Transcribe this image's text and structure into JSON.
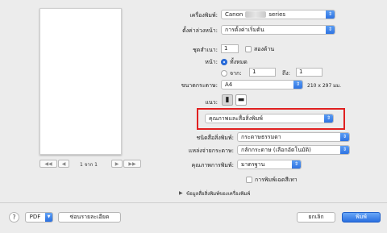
{
  "printer": {
    "label": "เครื่องพิมพ์:",
    "value_prefix": "Canon",
    "value_suffix": "series"
  },
  "presets": {
    "label": "ตั้งค่าล่วงหน้า:",
    "value": "การตั้งค่าเริ่มต้น"
  },
  "copies": {
    "label": "ชุดสำเนา:",
    "value": "1",
    "two_sided_label": "สองด้าน"
  },
  "pages": {
    "label": "หน้า:",
    "all_label": "ทั้งหมด",
    "from_label": "จาก:",
    "from_value": "1",
    "to_label": "ถึง:",
    "to_value": "1"
  },
  "paper_size": {
    "label": "ขนาดกระดาษ:",
    "value": "A4",
    "dimensions": "210 x 297 มม."
  },
  "orientation": {
    "label": "แนว:"
  },
  "section_popup": {
    "value": "คุณภาพและสื่อสิ่งพิมพ์"
  },
  "media_type": {
    "label": "ชนิดสื่อสิ่งพิมพ์:",
    "value": "กระดาษธรรมดา"
  },
  "paper_source": {
    "label": "แหล่งจ่ายกระดาษ:",
    "value": "กลักกระดาษ (เลือกอัตโนมัติ)"
  },
  "print_quality": {
    "label": "คุณภาพการพิมพ์:",
    "value": "มาตรฐาน"
  },
  "grayscale": {
    "label": "การพิมพ์เฉดสีเทา"
  },
  "printer_info": {
    "label": "ข้อมูลสื่อสิ่งพิมพ์ของเครื่องพิมพ์"
  },
  "preview": {
    "page_label": "1 จาก 1"
  },
  "footer": {
    "help": "?",
    "pdf": "PDF",
    "hide_details": "ซ่อนรายละเอียด",
    "cancel": "ยกเลิก",
    "print": "พิมพ์"
  },
  "colors": {
    "accent": "#2a6fe0",
    "highlight_box": "#e02020"
  }
}
